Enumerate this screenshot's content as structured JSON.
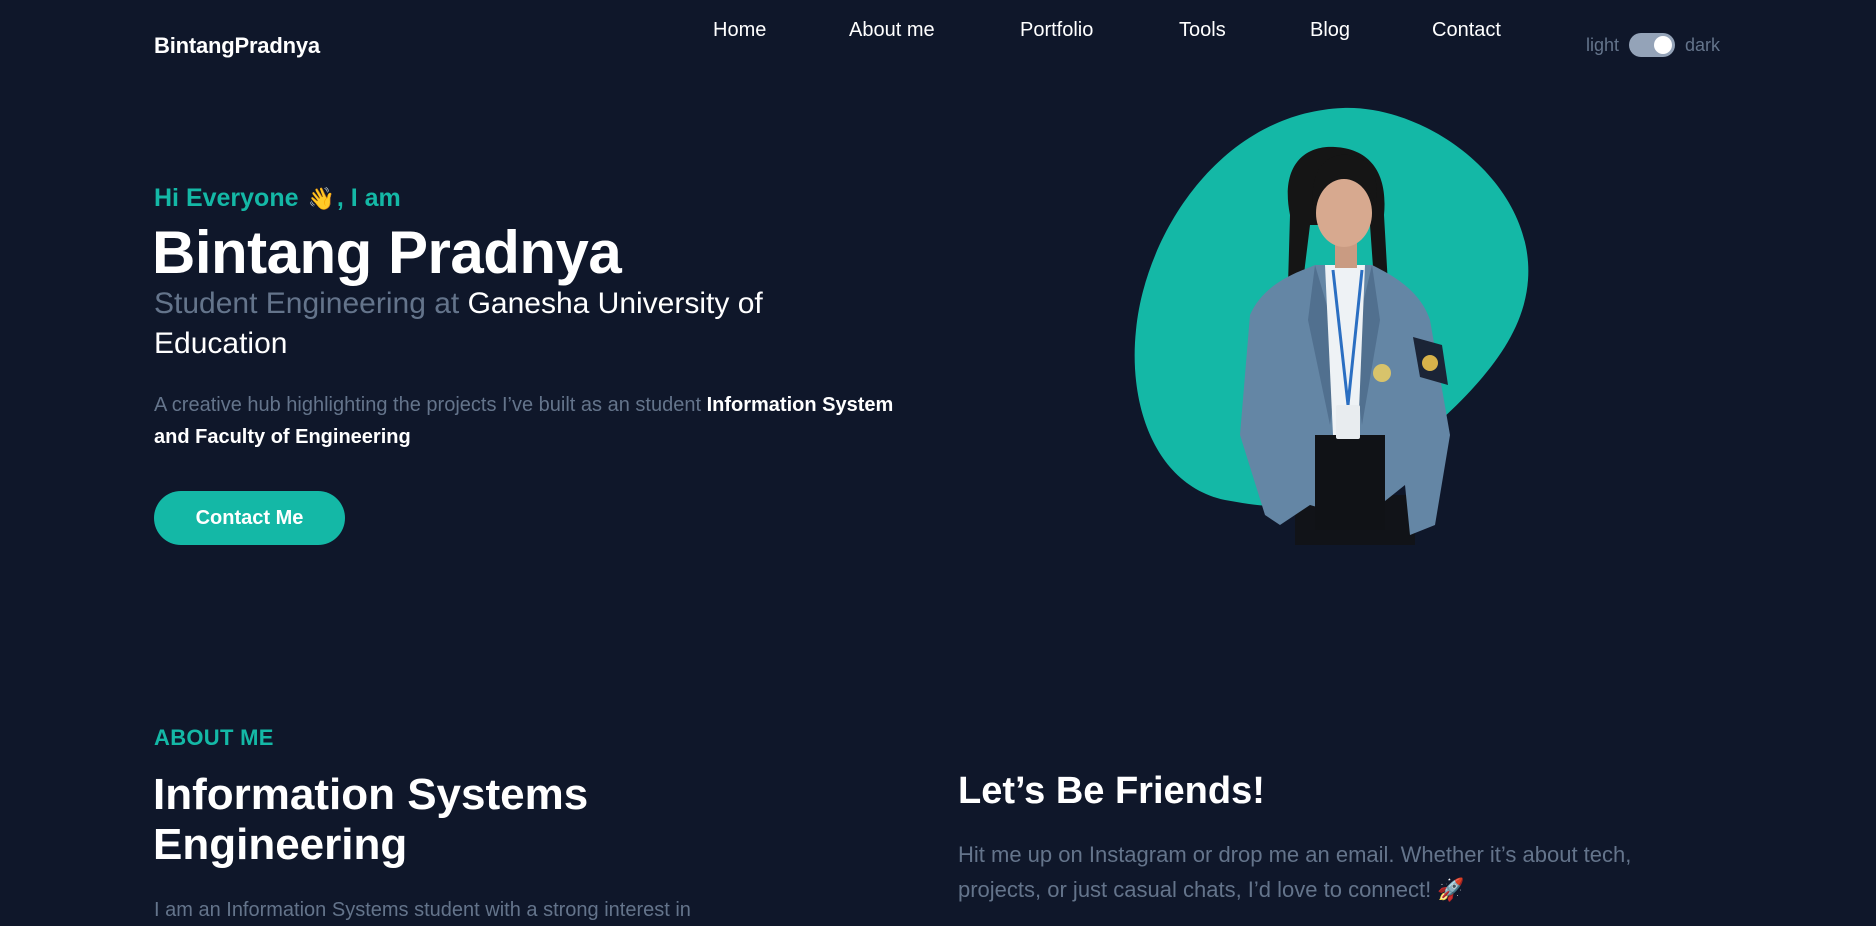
{
  "header": {
    "brand": "BintangPradnya",
    "nav": {
      "home": "Home",
      "about": "About me",
      "portfolio": "Portfolio",
      "tools": "Tools",
      "blog": "Blog",
      "contact": "Contact"
    },
    "theme": {
      "light_label": "light",
      "dark_label": "dark",
      "active": "dark"
    }
  },
  "hero": {
    "greeting_pre": "Hi Everyone",
    "greeting_emoji": "👋",
    "greeting_post": ", I am",
    "name": "Bintang Pradnya",
    "subtitle_muted": "Student Engineering at",
    "subtitle_highlight": "Ganesha University of Education",
    "description_muted": "A creative hub highlighting the projects I’ve built as an student",
    "description_strong": "Information System and Faculty of Engineering",
    "cta_label": "Contact Me"
  },
  "about": {
    "section_label": "ABOUT ME",
    "heading": "Information Systems Engineering",
    "text": "I am an Information Systems student with a strong interest in"
  },
  "friends": {
    "heading": "Let’s Be Friends!",
    "text": "Hit me up on Instagram or drop me an email. Whether it’s about tech, projects, or just casual chats, I’d love to connect! 🚀"
  },
  "colors": {
    "background": "#0f172a",
    "accent": "#14b8a6",
    "muted_text": "#64748b",
    "text": "#ffffff"
  }
}
